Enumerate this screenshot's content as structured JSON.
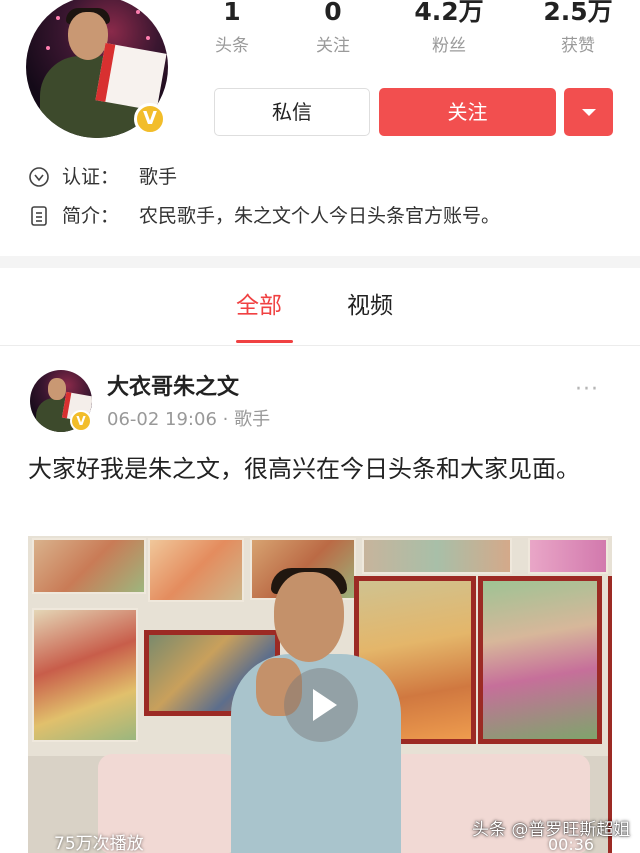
{
  "profile": {
    "stats": [
      {
        "value": "1",
        "label": "头条"
      },
      {
        "value": "0",
        "label": "关注"
      },
      {
        "value": "4.2万",
        "label": "粉丝"
      },
      {
        "value": "2.5万",
        "label": "获赞"
      }
    ],
    "message_button": "私信",
    "follow_button": "关注",
    "verification": {
      "key": "认证：",
      "value": "歌手"
    },
    "intro": {
      "key": "简介：",
      "value": "农民歌手，朱之文个人今日头条官方账号。"
    },
    "badge_glyph": "V"
  },
  "tabs": [
    {
      "label": "全部",
      "active": true
    },
    {
      "label": "视频",
      "active": false
    }
  ],
  "post": {
    "author": "大衣哥朱之文",
    "time": "06-02 19:06",
    "separator": "·",
    "category": "歌手",
    "more_glyph": "···",
    "text": "大家好我是朱之文，很高兴在今日头条和大家见面。",
    "video": {
      "play_count": "75万次播放",
      "duration": "00:36"
    }
  },
  "watermark": "头条 @普罗旺斯超姐",
  "colors": {
    "accent": "#f04142",
    "follow_button": "#f24f4f",
    "verify_badge": "#f2bd2a",
    "muted_text": "#999999"
  },
  "icons": {
    "verification": "chevron-down-circle-icon",
    "intro": "document-icon",
    "more": "more-dots-icon",
    "play": "play-icon"
  }
}
